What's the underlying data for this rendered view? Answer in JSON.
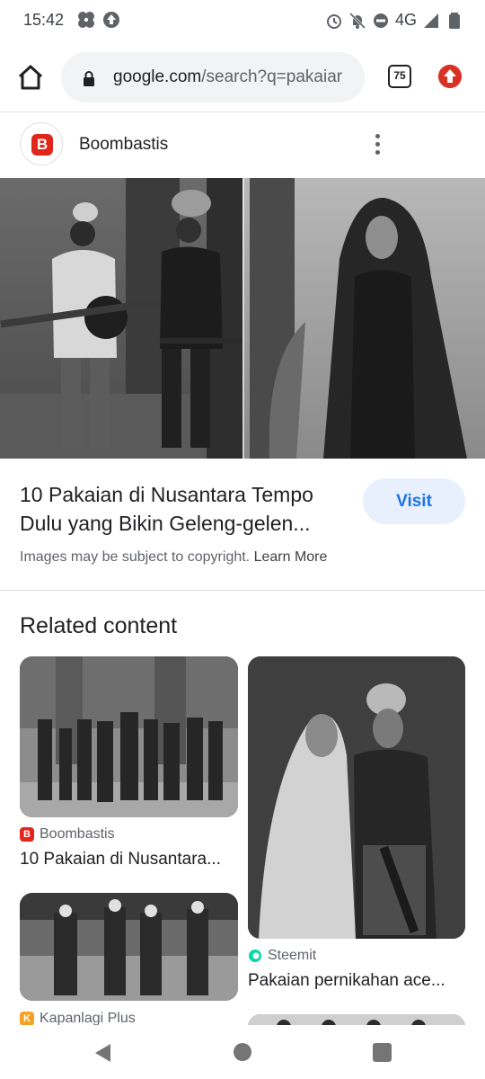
{
  "status_bar": {
    "time": "15:42",
    "network": "4G",
    "left_icons": [
      "pinwheel-icon",
      "upload-circle-icon"
    ],
    "right_icons": [
      "alarm-icon",
      "notifications-off-icon",
      "do-not-disturb-icon",
      "signal-icon",
      "battery-icon"
    ]
  },
  "browser": {
    "url_domain": "google.com",
    "url_rest": "/search?q=pakaiar",
    "tab_count": "75",
    "update_color": "#d93025"
  },
  "result": {
    "source_name": "Boombastis",
    "title": "10 Pakaian di Nusantara Tempo Dulu yang Bikin Geleng-gelen...",
    "visit_label": "Visit",
    "copyright_text": "Images may be subject to copyright.",
    "learn_more_label": "Learn More"
  },
  "related": {
    "heading": "Related content",
    "cards": [
      {
        "source": "Boombastis",
        "title": "10 Pakaian di Nusantara...",
        "favicon_color": "#e1261c",
        "favicon_letter": "B"
      },
      {
        "source": "Steemit",
        "title": "Pakaian pernikahan ace...",
        "favicon_color": "#07d7a9",
        "favicon_letter": ""
      },
      {
        "source": "Kapanlagi Plus",
        "title": "",
        "favicon_color": "#f4a224",
        "favicon_letter": "K"
      }
    ]
  },
  "colors": {
    "accent": "#1a73e8",
    "visit_bg": "#e8f0fe",
    "brand_boombastis": "#e1261c"
  }
}
